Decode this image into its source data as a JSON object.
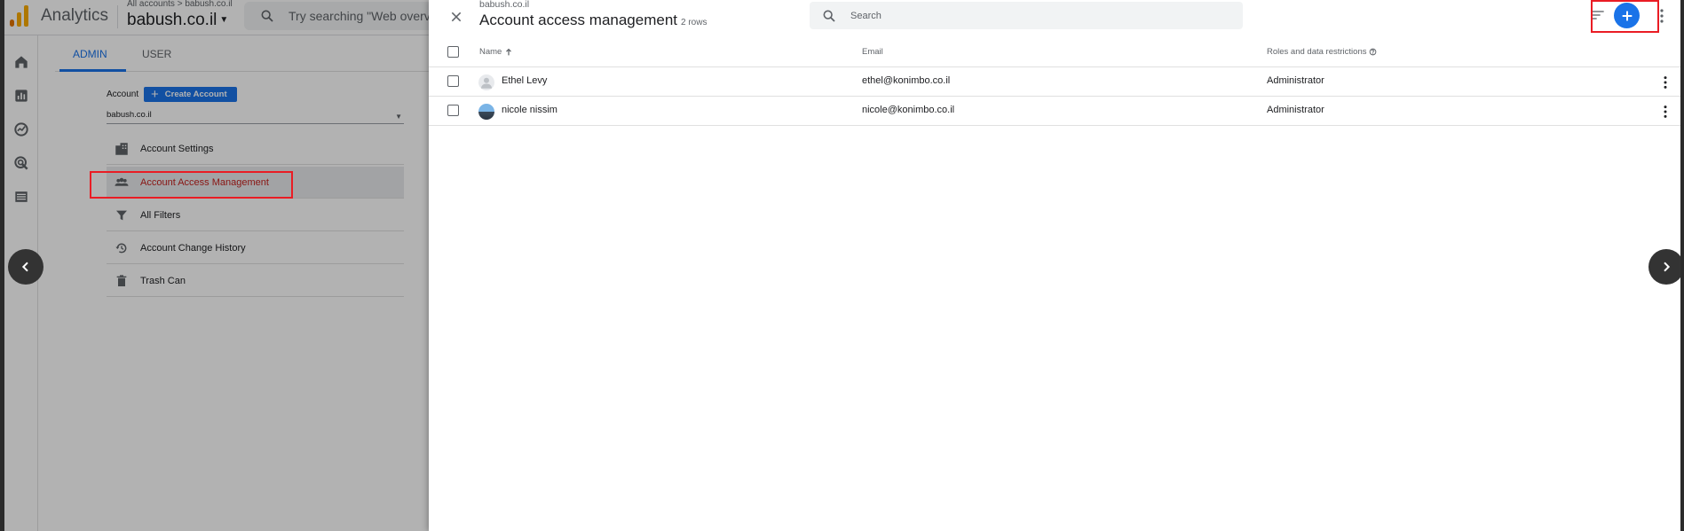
{
  "app": {
    "brand": "Analytics",
    "breadcrumb": "All accounts > babush.co.il",
    "property": "babush.co.il",
    "search_placeholder": "Try searching \"Web overv",
    "tabs": {
      "admin": "ADMIN",
      "user": "USER"
    },
    "account_label": "Account",
    "create_account": "Create Account",
    "account_selected": "babush.co.il",
    "menu": [
      {
        "label": "Account Settings",
        "icon": "building-icon"
      },
      {
        "label": "Account Access Management",
        "icon": "people-icon",
        "active": true
      },
      {
        "label": "All Filters",
        "icon": "filter-icon"
      },
      {
        "label": "Account Change History",
        "icon": "history-icon"
      },
      {
        "label": "Trash Can",
        "icon": "trash-icon"
      }
    ],
    "rail_icons": [
      "home-icon",
      "reports-icon",
      "explore-icon",
      "advertising-icon",
      "list-icon"
    ]
  },
  "panel": {
    "subtitle": "babush.co.il",
    "title": "Account access management",
    "row_count": "2 rows",
    "search_placeholder": "Search",
    "columns": {
      "name": "Name",
      "email": "Email",
      "roles": "Roles and data restrictions"
    },
    "rows": [
      {
        "name": "Ethel Levy",
        "email": "ethel@konimbo.co.il",
        "role": "Administrator",
        "avatar": "default-avatar"
      },
      {
        "name": "nicole nissim",
        "email": "nicole@konimbo.co.il",
        "role": "Administrator",
        "avatar": "photo-avatar"
      }
    ]
  },
  "colors": {
    "accent": "#1a73e8",
    "highlight": "#ea1c24",
    "logo_orange": "#f9ab00"
  }
}
